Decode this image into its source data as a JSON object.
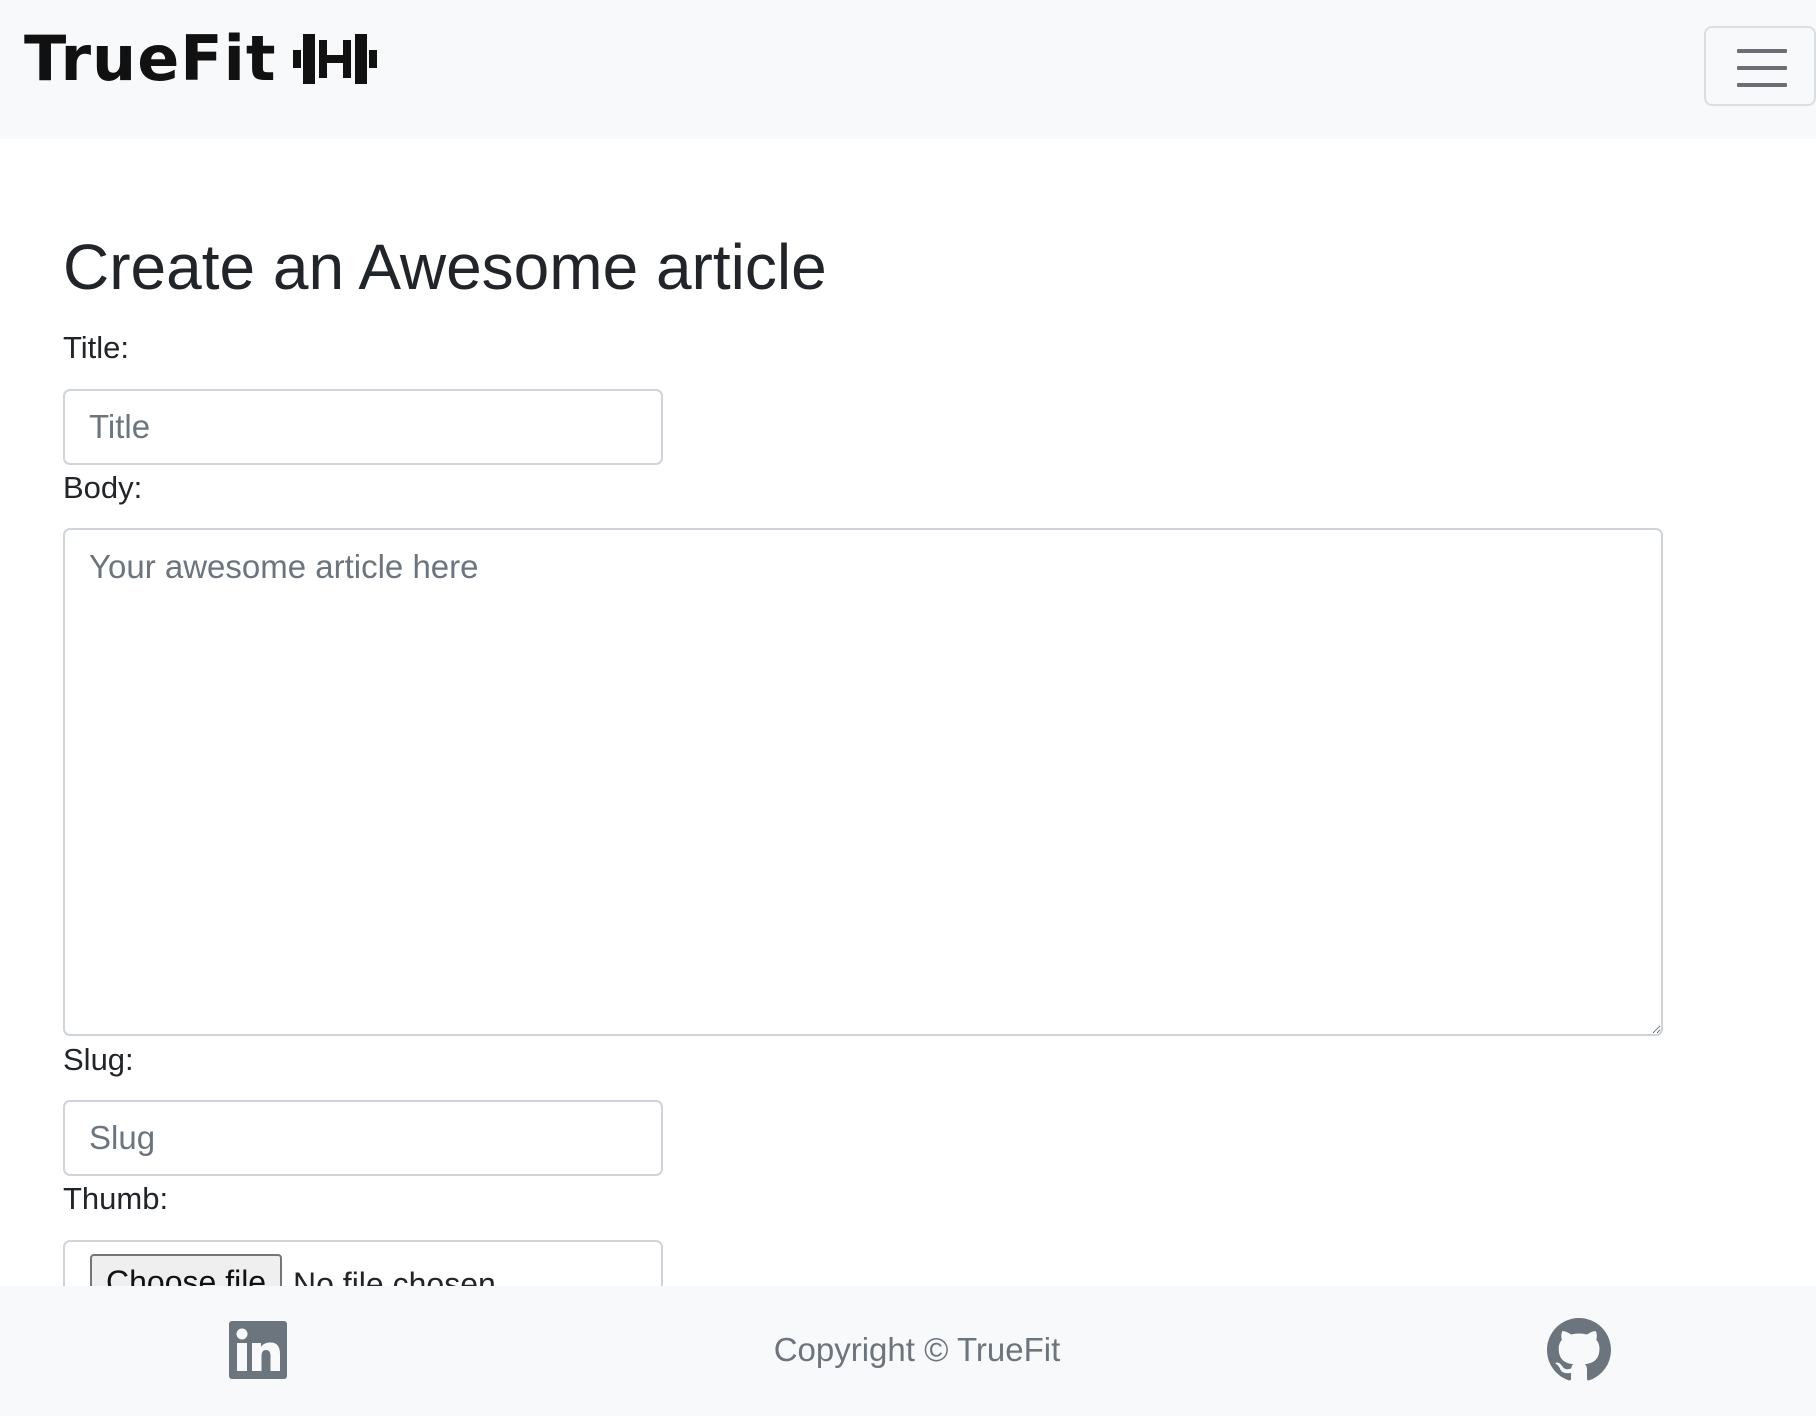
{
  "navbar": {
    "brand": "TrueFit",
    "brand_icon": "dumbbell-icon",
    "toggle_icon": "hamburger-menu-icon"
  },
  "form": {
    "heading": "Create an Awesome article",
    "title_label": "Title:",
    "title_placeholder": "Title",
    "body_label": "Body:",
    "body_placeholder": "Your awesome article here",
    "slug_label": "Slug:",
    "slug_placeholder": "Slug",
    "thumb_label": "Thumb:",
    "file_button": "Choose file",
    "file_status": "No file chosen"
  },
  "footer": {
    "copyright": "Copyright © TrueFit",
    "linkedin_icon": "linkedin-icon",
    "github_icon": "github-icon"
  },
  "colors": {
    "navbar_bg": "#f8f9fa",
    "footer_bg": "#f8f9fa",
    "text": "#212529",
    "muted": "#6c757d",
    "input_border": "#ced4da"
  }
}
